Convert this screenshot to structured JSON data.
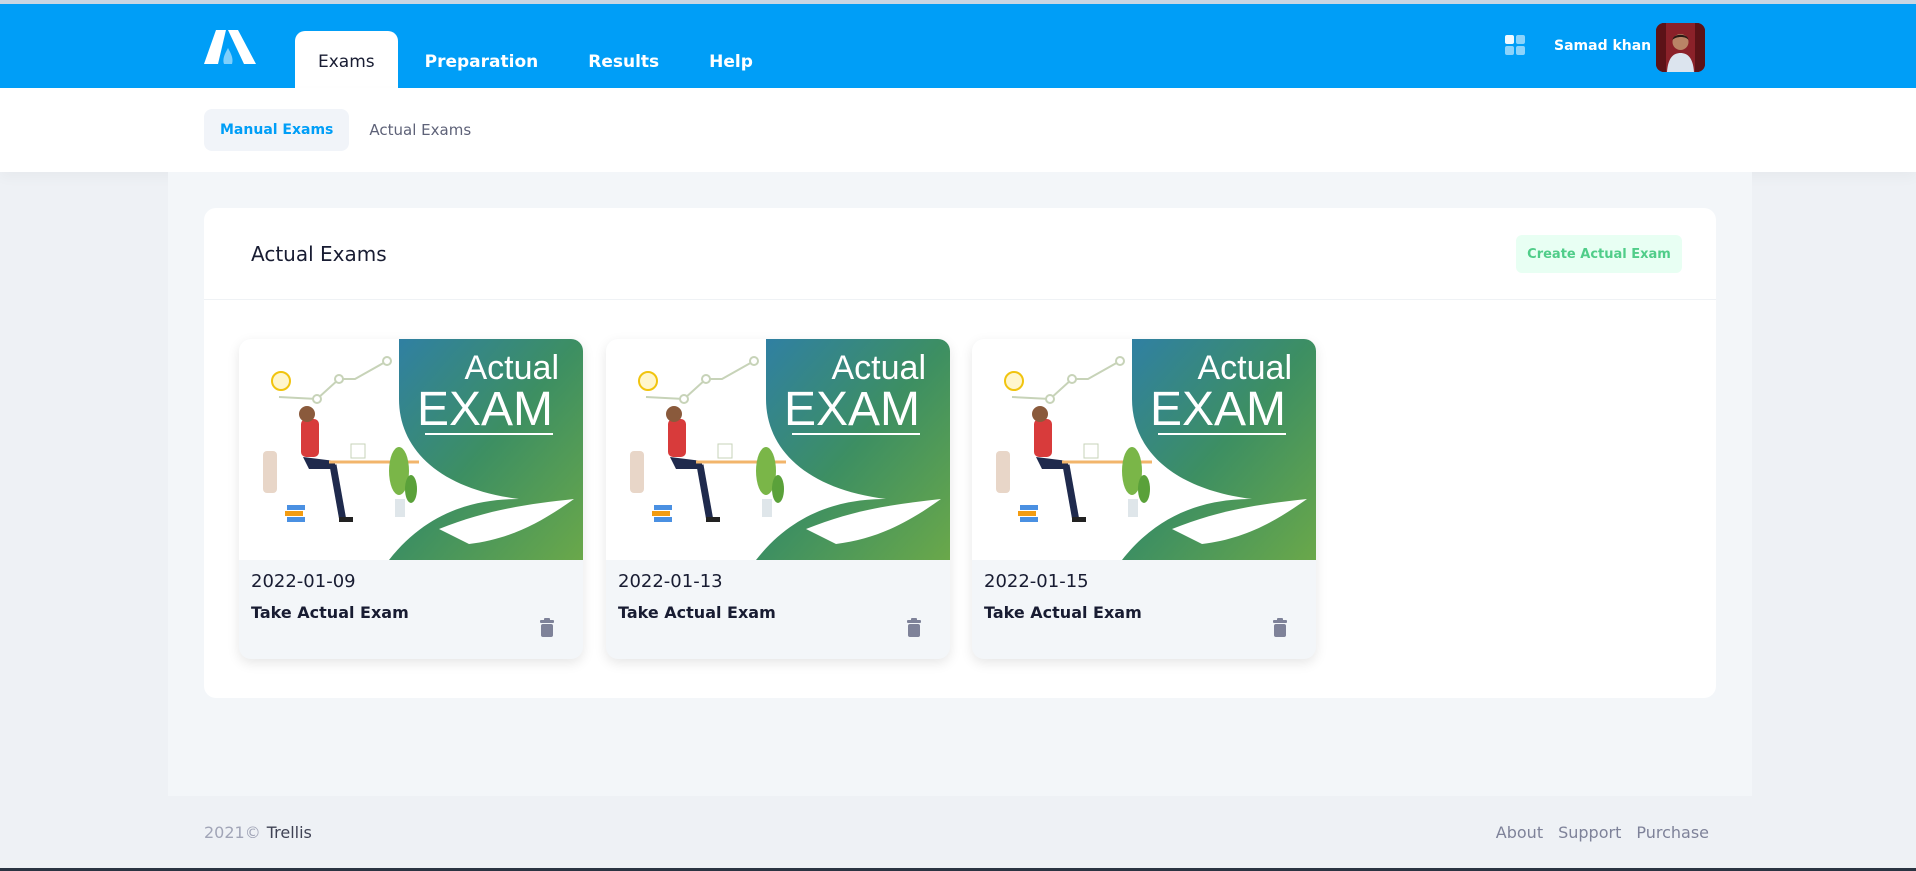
{
  "header": {
    "nav_tabs": [
      {
        "label": "Exams"
      },
      {
        "label": "Preparation"
      },
      {
        "label": "Results"
      },
      {
        "label": "Help"
      }
    ],
    "user_name": "Samad khan",
    "icons": {
      "logo": "logo",
      "apps": "apps-grid-icon"
    },
    "accent_color": "#009ef7"
  },
  "subnav": {
    "tabs": [
      {
        "label": "Manual Exams"
      },
      {
        "label": "Actual Exams"
      }
    ]
  },
  "main": {
    "title": "Actual Exams",
    "create_button_label": "Create Actual Exam",
    "exams": [
      {
        "date": "2022-01-09",
        "action_label": "Take Actual Exam",
        "image_text_line1": "Actual",
        "image_text_line2": "EXAM"
      },
      {
        "date": "2022-01-13",
        "action_label": "Take Actual Exam",
        "image_text_line1": "Actual",
        "image_text_line2": "EXAM"
      },
      {
        "date": "2022-01-15",
        "action_label": "Take Actual Exam",
        "image_text_line1": "Actual",
        "image_text_line2": "EXAM"
      }
    ]
  },
  "footer": {
    "year": "2021©",
    "brand": "Trellis",
    "links": [
      {
        "label": "About"
      },
      {
        "label": "Support"
      },
      {
        "label": "Purchase"
      }
    ]
  }
}
